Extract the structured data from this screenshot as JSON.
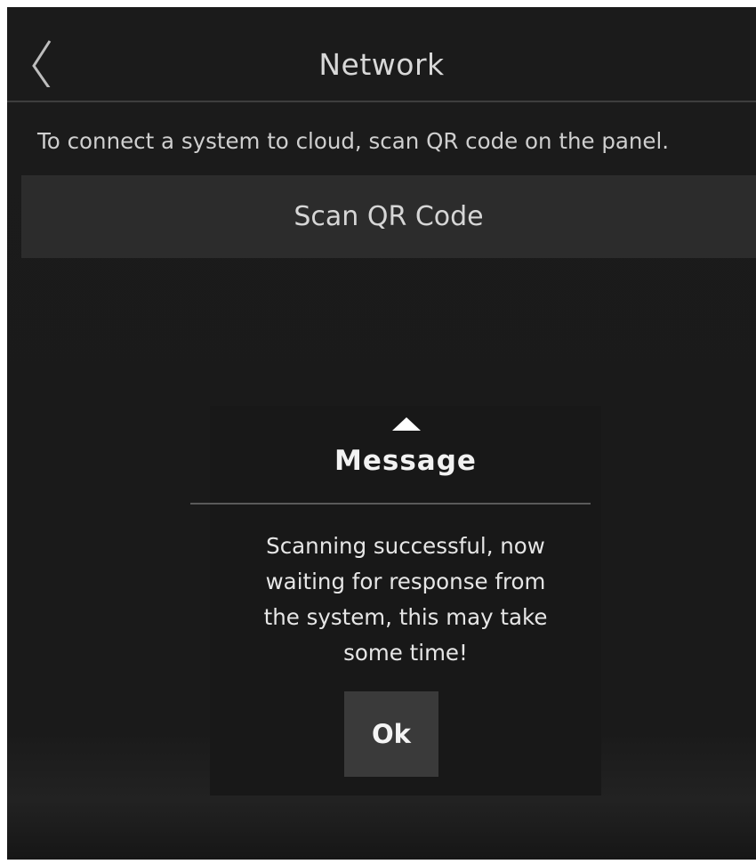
{
  "header": {
    "title": "Network",
    "back_icon": "chevron-left-icon"
  },
  "main": {
    "instruction": "To connect a system to cloud, scan QR code on the panel.",
    "scan_button_label": "Scan QR Code"
  },
  "dialog": {
    "icon": "triangle-up-icon",
    "title": "Message",
    "message_lines": [
      "Scanning successful, now",
      "waiting for response from",
      "the system, this may take",
      "some time!"
    ],
    "ok_label": "Ok"
  },
  "colors": {
    "background": "#1b1b1b",
    "button": "#2c2c2c",
    "ok_button": "#3a3a3a",
    "text": "#d8d8d8"
  }
}
